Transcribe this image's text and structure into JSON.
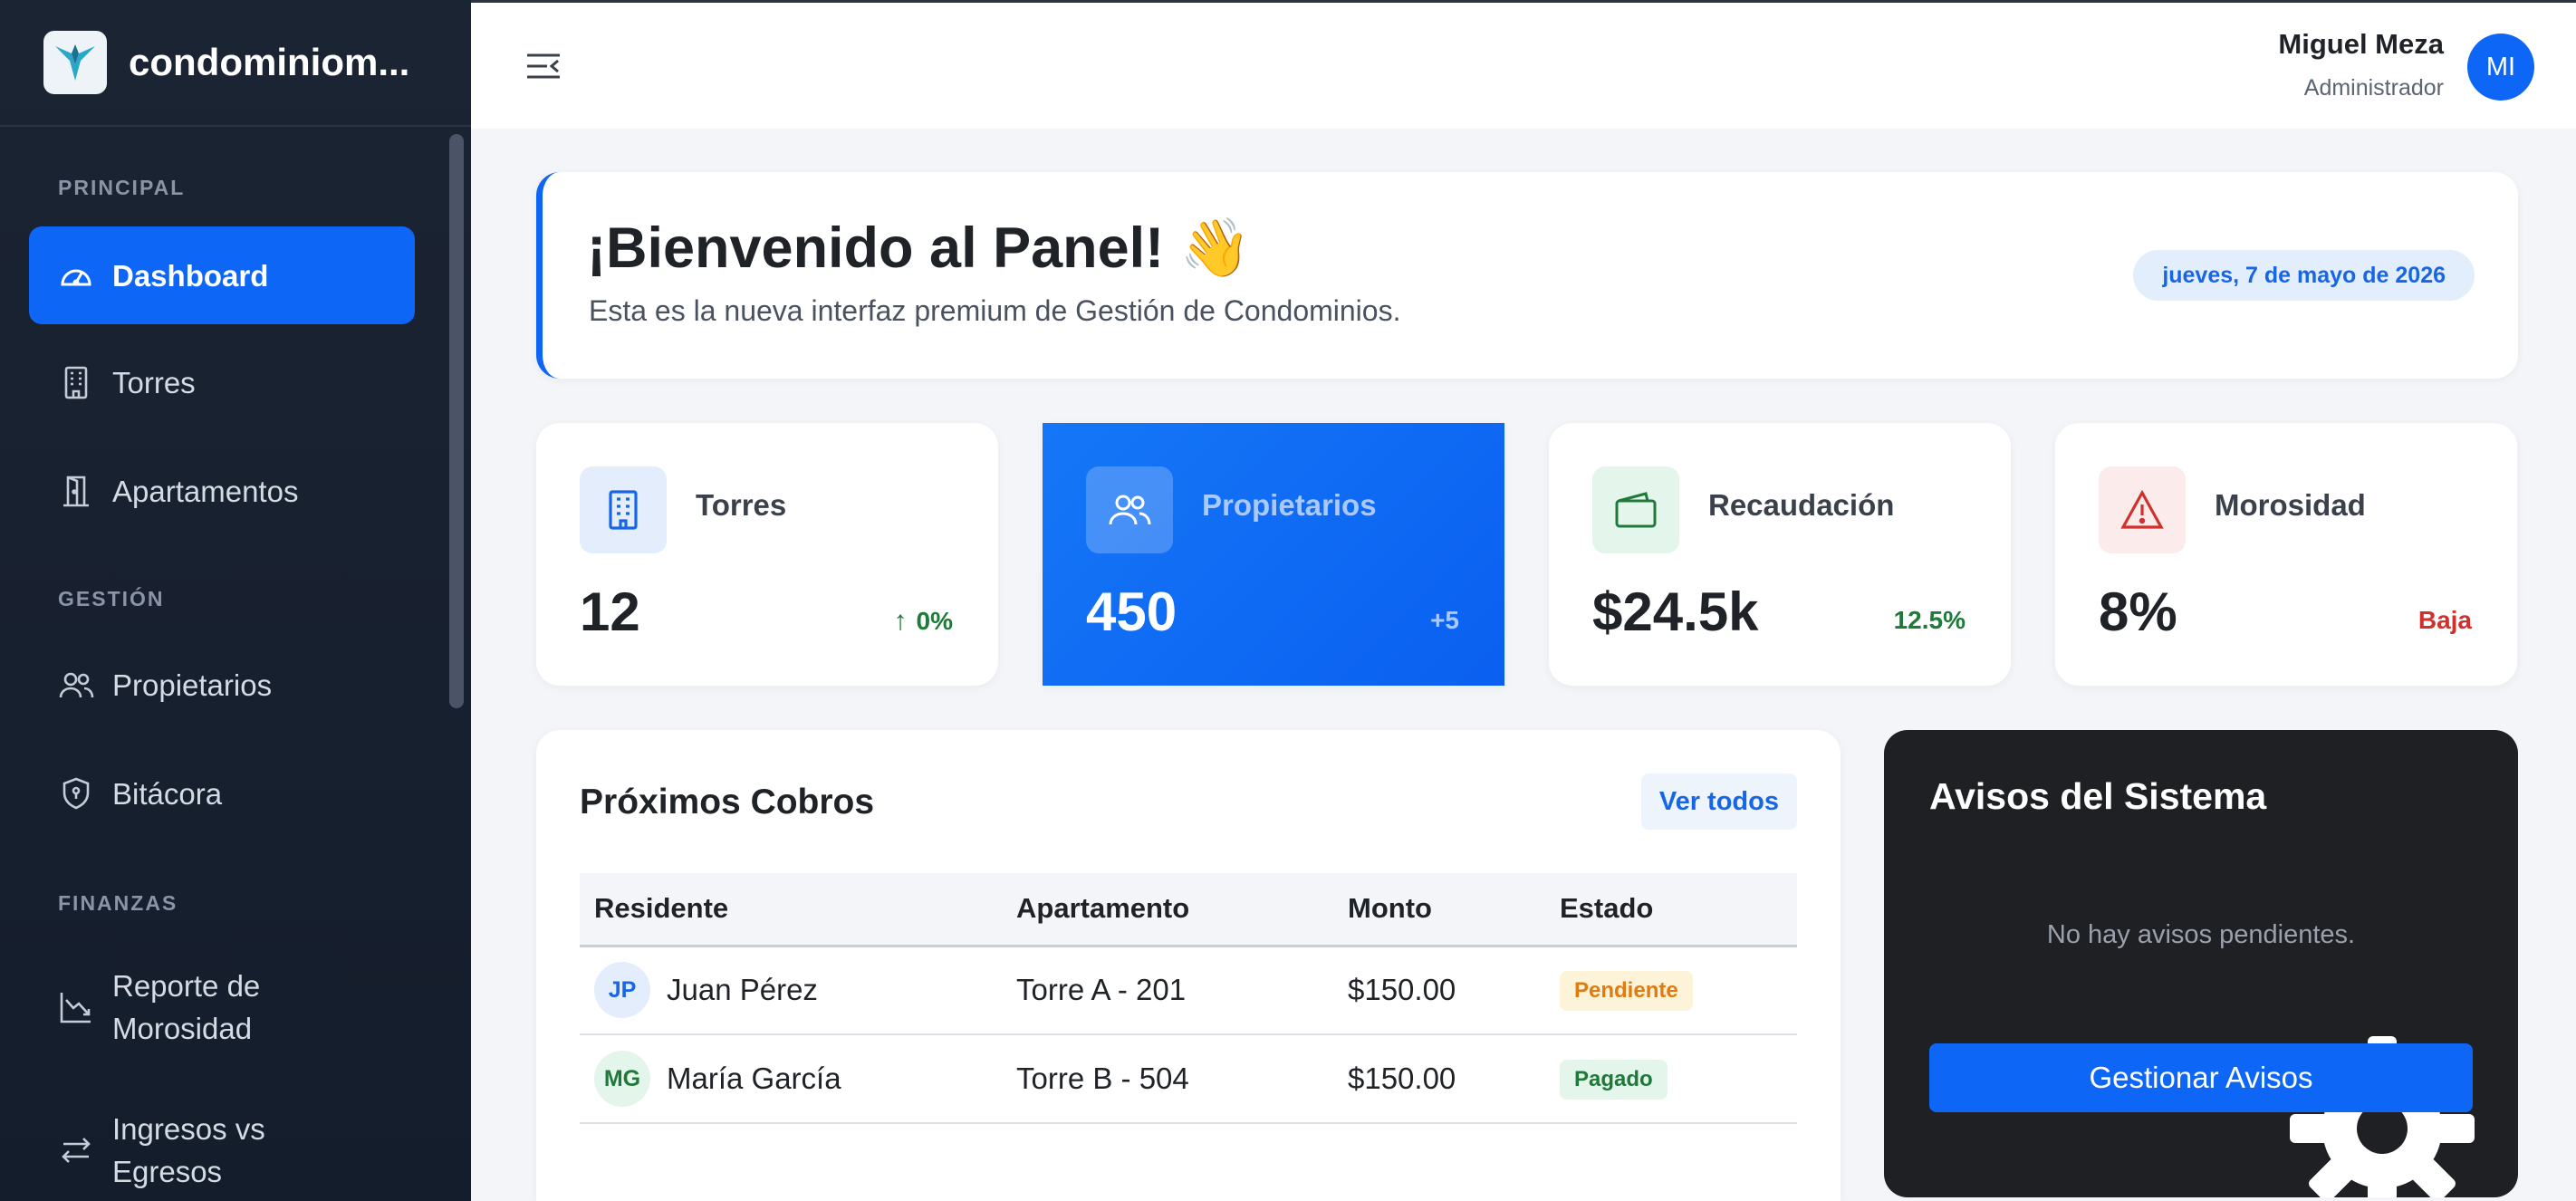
{
  "app": {
    "brand": "condominiom..."
  },
  "sidebar": {
    "sections": [
      {
        "label": "PRINCIPAL"
      },
      {
        "label": "GESTIÓN"
      },
      {
        "label": "FINANZAS"
      }
    ],
    "items": [
      {
        "label": "Dashboard",
        "icon": "gauge-icon",
        "active": true
      },
      {
        "label": "Torres",
        "icon": "building-icon"
      },
      {
        "label": "Apartamentos",
        "icon": "door-icon"
      },
      {
        "label": "Propietarios",
        "icon": "users-icon"
      },
      {
        "label": "Bitácora",
        "icon": "shield-icon"
      },
      {
        "label": "Reporte de\nMorosidad",
        "icon": "chart-down-icon"
      },
      {
        "label": "Ingresos vs\nEgresos",
        "icon": "arrows-icon"
      }
    ]
  },
  "header": {
    "user_name": "Miguel Meza",
    "user_role": "Administrador",
    "avatar_initials": "MI"
  },
  "welcome": {
    "title": "¡Bienvenido al Panel! 👋",
    "subtitle": "Esta es la nueva interfaz premium de Gestión de Condominios.",
    "date": "jueves, 7 de mayo de 2026"
  },
  "stats": [
    {
      "label": "Torres",
      "value": "12",
      "trend": "0%",
      "trend_arrow": "↑",
      "icon": "building-icon",
      "trend_color": "#1f7a3a"
    },
    {
      "label": "Propietarios",
      "value": "450",
      "trend": "+5",
      "icon": "users-icon",
      "trend_color": "#a9c9ff"
    },
    {
      "label": "Recaudación",
      "value": "$24.5k",
      "trend": "12.5%",
      "icon": "wallet-icon",
      "trend_color": "#1f7a3a"
    },
    {
      "label": "Morosidad",
      "value": "8%",
      "trend": "Baja",
      "icon": "alert-triangle-icon",
      "trend_color": "#d0312d"
    }
  ],
  "cobros": {
    "title": "Próximos Cobros",
    "view_all": "Ver todos",
    "columns": [
      "Residente",
      "Apartamento",
      "Monto",
      "Estado"
    ],
    "rows": [
      {
        "initials": "JP",
        "name": "Juan Pérez",
        "apartment": "Torre A - 201",
        "amount": "$150.00",
        "status": "Pendiente"
      },
      {
        "initials": "MG",
        "name": "María García",
        "apartment": "Torre B - 504",
        "amount": "$150.00",
        "status": "Pagado"
      }
    ]
  },
  "avisos": {
    "title": "Avisos del Sistema",
    "empty": "No hay avisos pendientes.",
    "button": "Gestionar Avisos"
  },
  "colors": {
    "accent": "#0d66f5",
    "sidebar_bg": "#1b2433",
    "success": "#1f7a3a",
    "danger": "#d0312d",
    "warning": "#e07b12"
  }
}
